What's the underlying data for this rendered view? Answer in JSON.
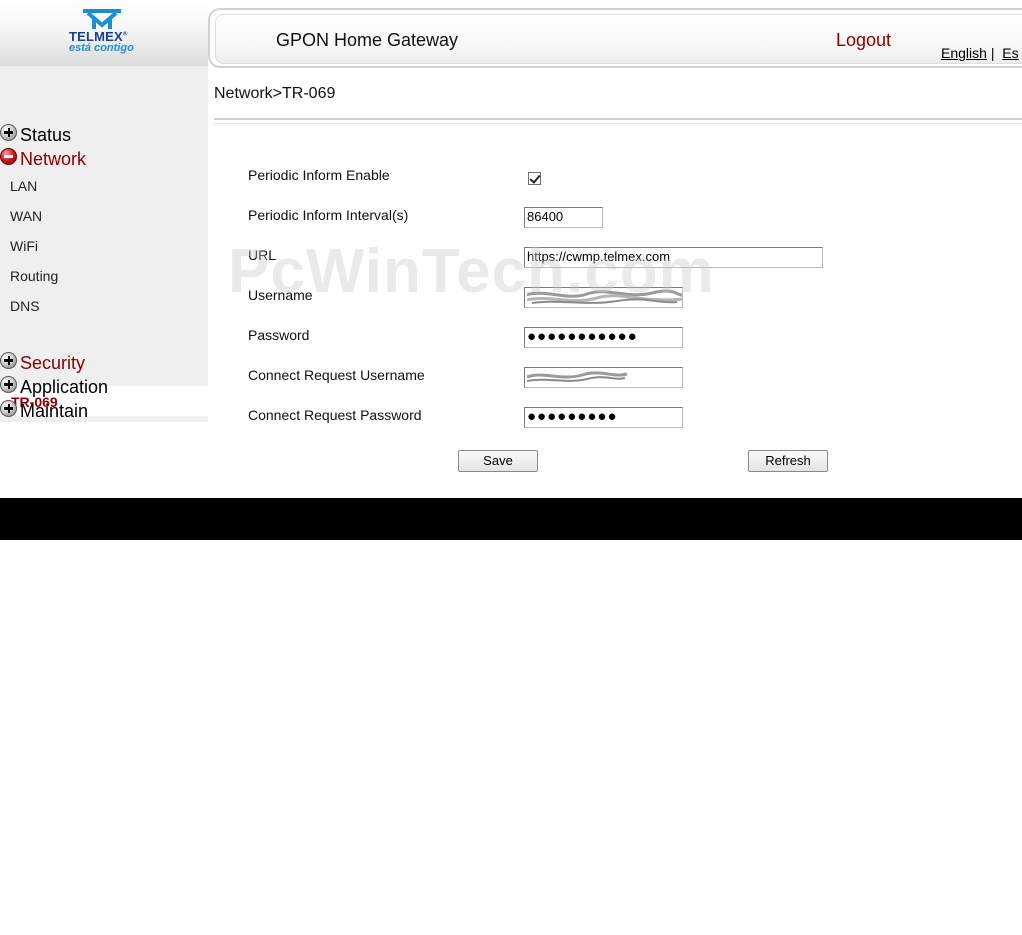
{
  "header": {
    "brand": "TELMEX",
    "tagline": "está contigo",
    "title": "GPON Home Gateway",
    "logout": "Logout",
    "lang_english": "English",
    "lang_sep": "|",
    "lang_other": "Es"
  },
  "sidebar": {
    "status": "Status",
    "network": "Network",
    "network_items": [
      "LAN",
      "WAN",
      "WiFi",
      "Routing",
      "DNS"
    ],
    "active_item": "TR-069",
    "security": "Security",
    "application": "Application",
    "maintain": "Maintain"
  },
  "breadcrumb": "Network>TR-069",
  "form": {
    "periodic_enable_label": "Periodic Inform Enable",
    "periodic_enable_checked": true,
    "interval_label": "Periodic Inform Interval(s)",
    "interval_value": "86400",
    "url_label": "URL",
    "url_value": "https://cwmp.telmex.com",
    "username_label": "Username",
    "password_label": "Password",
    "password_mask": "●●●●●●●●●●●",
    "cr_username_label": "Connect Request Username",
    "cr_password_label": "Connect Request Password",
    "cr_password_mask": "●●●●●●●●●"
  },
  "buttons": {
    "save": "Save",
    "refresh": "Refresh"
  },
  "watermark": "PcWinTech.com",
  "colors": {
    "accent_red": "#8b0000",
    "brand_blue": "#1b3f8f",
    "footer": "#000000"
  }
}
